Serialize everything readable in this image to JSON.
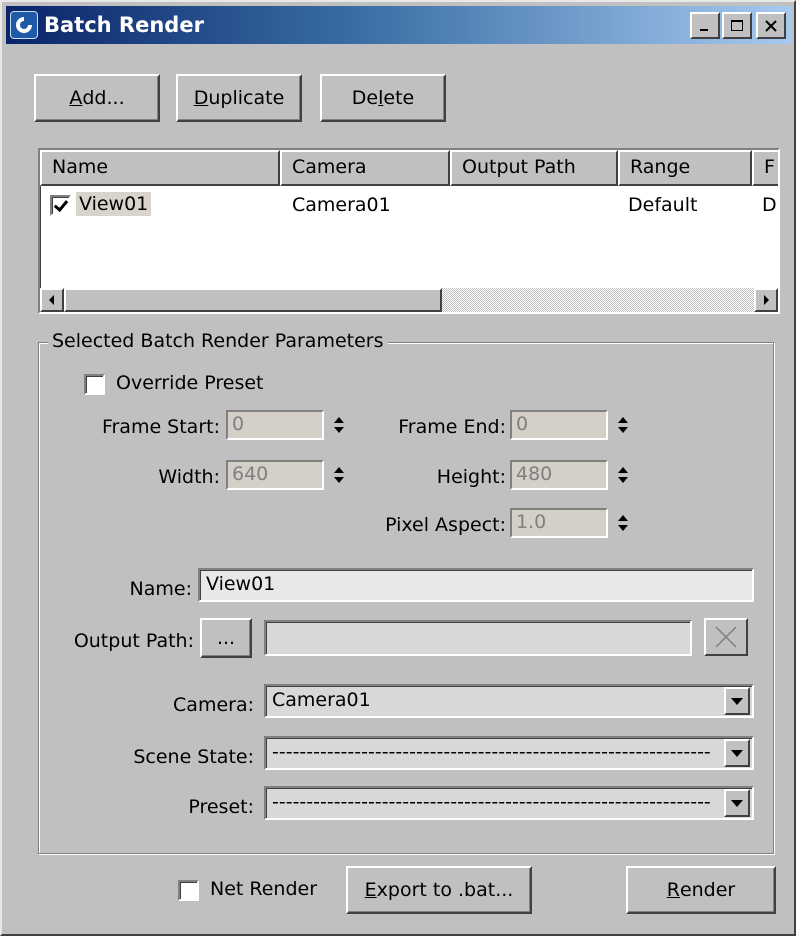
{
  "window": {
    "title": "Batch Render",
    "controls": {
      "minimize": "minimize-icon",
      "maximize": "maximize-icon",
      "close": "close-icon"
    }
  },
  "toolbar": {
    "add": {
      "prefix": "",
      "mnemonic": "A",
      "suffix": "dd..."
    },
    "duplicate": {
      "prefix": "",
      "mnemonic": "D",
      "suffix": "uplicate"
    },
    "delete": {
      "prefix": "De",
      "mnemonic": "l",
      "suffix": "ete"
    }
  },
  "list": {
    "columns": [
      "Name",
      "Camera",
      "Output Path",
      "Range",
      "F"
    ],
    "rows": [
      {
        "checked": true,
        "name": "View01",
        "camera": "Camera01",
        "output_path": "",
        "range": "Default",
        "extra": "D"
      }
    ]
  },
  "params": {
    "group_label": "Selected Batch Render Parameters",
    "override_preset": {
      "label": "Override Preset",
      "checked": false
    },
    "frame_start": {
      "label": "Frame Start:",
      "value": "0"
    },
    "frame_end": {
      "label": "Frame End:",
      "value": "0"
    },
    "width": {
      "label": "Width:",
      "value": "640"
    },
    "height": {
      "label": "Height:",
      "value": "480"
    },
    "pixel_aspect": {
      "label": "Pixel Aspect:",
      "value": "1.0"
    },
    "name": {
      "label": "Name:",
      "value": "View01"
    },
    "output_path": {
      "label": "Output Path:",
      "browse": "...",
      "value": ""
    },
    "camera": {
      "label": "Camera:",
      "value": "Camera01"
    },
    "scene_state": {
      "label": "Scene State:",
      "value": "----------------------------------------------------------------"
    },
    "preset": {
      "label": "Preset:",
      "value": "----------------------------------------------------------------"
    }
  },
  "footer": {
    "net_render": {
      "label": "Net Render",
      "checked": false
    },
    "export": {
      "prefix": "",
      "mnemonic": "E",
      "suffix": "xport to .bat..."
    },
    "render": {
      "prefix": "",
      "mnemonic": "R",
      "suffix": "ender"
    }
  },
  "colors": {
    "title_start": "#0a246a",
    "title_end": "#a6caf0",
    "face": "#c0c0c0"
  }
}
